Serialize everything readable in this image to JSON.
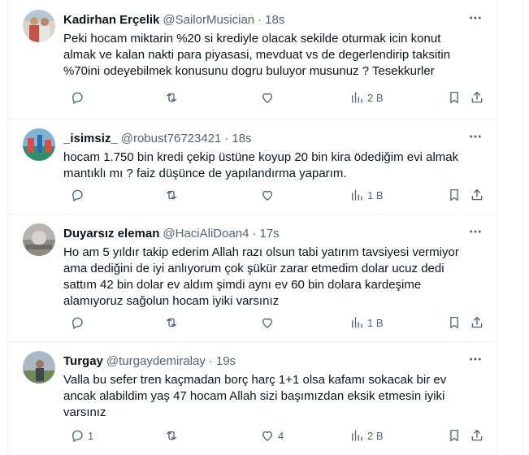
{
  "tweets": [
    {
      "name": "Kadirhan Erçelik",
      "handle": "@SailorMusician",
      "time": "18s",
      "text": "Peki hocam miktarin %20 si krediyle olacak sekilde oturmak icin konut almak ve kalan nakti para piyasasi, mevduat vs de degerlendirip taksitin %70ini odeyebilmek konusunu dogru buluyor musunuz ? Tesekkurler",
      "replies": "",
      "likes": "",
      "views": "2 B",
      "avatar_color": "#c8514a"
    },
    {
      "name": "_isimsiz_",
      "handle": "@robust76723421",
      "time": "18s",
      "text": "hocam 1.750 bin kredi çekip üstüne koyup 20 bin kira ödediğim evi almak mantıklı mı ? faiz düşünce de yapılandırma yaparım.",
      "replies": "",
      "likes": "",
      "views": "1 B",
      "avatar_color": "#2f8f6b"
    },
    {
      "name": "Duyarsız eleman",
      "handle": "@HaciAliDoan4",
      "time": "17s",
      "text": "Ho am 5 yıldır takip ederim Allah razı olsun tabi yatırım tavsiyesi vermiyor ama dediğini de iyi anlıyorum çok şükür zarar etmedim dolar ucuz dedi sattım 42 bin dolar ev aldım şimdi aynı ev 60 bin dolara kardeşime alamıyoruz sağolun hocam iyiki varsınız",
      "replies": "",
      "likes": "",
      "views": "1 B",
      "avatar_color": "#8e8a84"
    },
    {
      "name": "Turgay",
      "handle": "@turgaydemiralay",
      "time": "19s",
      "text": "Valla bu sefer tren kaçmadan borç harç 1+1 olsa kafamı sokacak bir ev ancak alabildim yaş 47 hocam Allah sizi başımızdan eksik etmesin iyiki varsınız",
      "replies": "1",
      "likes": "4",
      "views": "2 B",
      "avatar_color": "#6f8a5a"
    }
  ]
}
